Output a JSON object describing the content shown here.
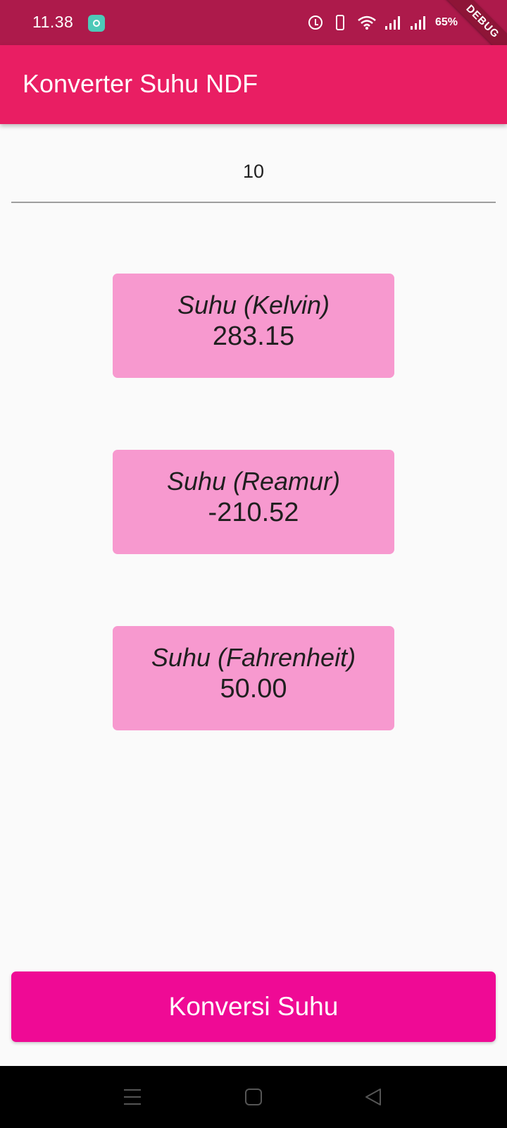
{
  "status_bar": {
    "time": "11.38",
    "battery": "65%"
  },
  "debug_banner": "DEBUG",
  "app_bar": {
    "title": "Konverter Suhu NDF",
    "color": "#e91e63"
  },
  "input": {
    "value": "10"
  },
  "results": [
    {
      "label": "Suhu (Kelvin)",
      "value": "283.15"
    },
    {
      "label": "Suhu (Reamur)",
      "value": "-210.52"
    },
    {
      "label": "Suhu (Fahrenheit)",
      "value": "50.00"
    }
  ],
  "card_color": "#f799cf",
  "convert_button": {
    "label": "Konversi Suhu",
    "color": "#ef0a95"
  },
  "nav_bar": {
    "icons": [
      "menu-icon",
      "home-icon",
      "back-icon"
    ]
  }
}
